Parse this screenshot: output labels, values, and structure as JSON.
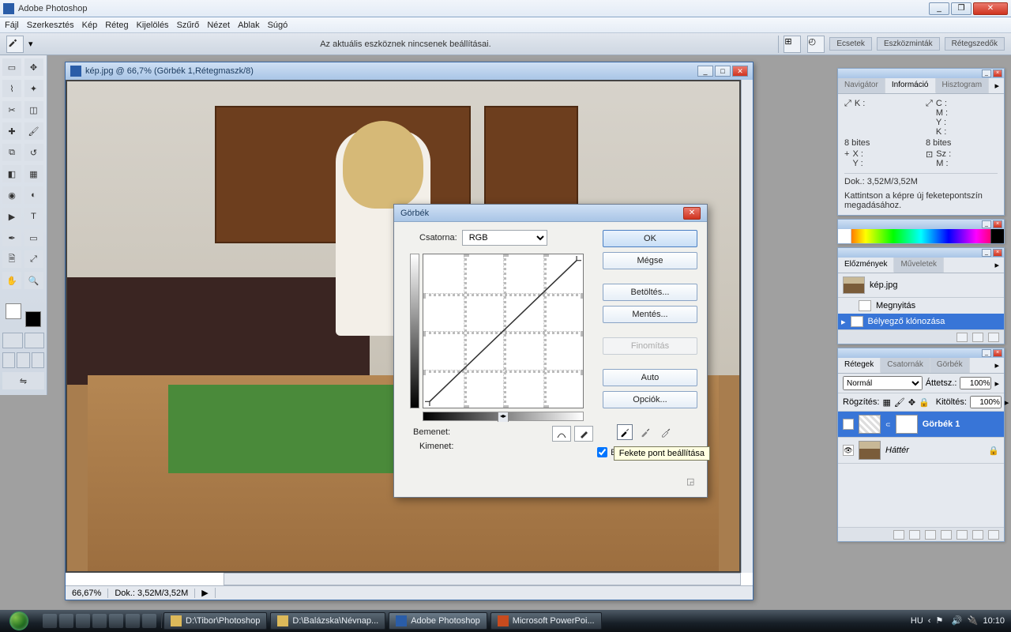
{
  "app": {
    "title": "Adobe Photoshop"
  },
  "menu": [
    "Fájl",
    "Szerkesztés",
    "Kép",
    "Réteg",
    "Kijelölés",
    "Szűrő",
    "Nézet",
    "Ablak",
    "Súgó"
  ],
  "optbar": {
    "message": "Az aktuális eszköznek nincsenek beállításai.",
    "tabs": [
      "Ecsetek",
      "Eszközminták",
      "Rétegszedők"
    ]
  },
  "doc": {
    "title": "kép.jpg @ 66,7% (Görbék 1,Rétegmaszk/8)",
    "zoom": "66,67%",
    "docsize": "Dok.: 3,52M/3,52M"
  },
  "dialog": {
    "title": "Görbék",
    "channel_label": "Csatorna:",
    "channel_value": "RGB",
    "input_label": "Bemenet:",
    "output_label": "Kimenet:",
    "btn_ok": "OK",
    "btn_cancel": "Mégse",
    "btn_load": "Betöltés...",
    "btn_save": "Mentés...",
    "btn_smooth": "Finomítás",
    "btn_auto": "Auto",
    "btn_options": "Opciók...",
    "preview_label": "Elő",
    "tooltip": "Fekete pont beállítása"
  },
  "panels": {
    "info": {
      "tabs": [
        "Navigátor",
        "Információ",
        "Hisztogram"
      ],
      "k_label": "K :",
      "cmyk": {
        "c": "C :",
        "m": "M :",
        "y": "Y :",
        "k": "K :"
      },
      "bits_left": "8 bites",
      "bits_right": "8 bites",
      "xy": {
        "x": "X :",
        "y": "Y :"
      },
      "szm": {
        "sz": "Sz :",
        "m": "M :"
      },
      "docsize": "Dok.: 3,52M/3,52M",
      "hint": "Kattintson a képre új feketepontszín megadásához."
    },
    "history": {
      "tabs": [
        "Előzmények",
        "Műveletek"
      ],
      "doc_name": "kép.jpg",
      "items": [
        "Megnyitás",
        "Bélyegző klónozása"
      ]
    },
    "layers": {
      "tabs": [
        "Rétegek",
        "Csatornák",
        "Görbék"
      ],
      "blend": "Normál",
      "opacity_label": "Áttetsz.:",
      "opacity": "100%",
      "lock_label": "Rögzítés:",
      "fill_label": "Kitöltés:",
      "fill": "100%",
      "items": [
        {
          "name": "Görbék 1",
          "locked": false
        },
        {
          "name": "Háttér",
          "locked": true
        }
      ]
    }
  },
  "taskbar": {
    "items": [
      {
        "label": "D:\\Tibor\\Photoshop",
        "color": "#dcb95a"
      },
      {
        "label": "D:\\Balázska\\Névnap...",
        "color": "#dcb95a"
      },
      {
        "label": "Adobe Photoshop",
        "color": "#2a5da8",
        "active": true
      },
      {
        "label": "Microsoft PowerPoi...",
        "color": "#c84b1e"
      }
    ],
    "lang": "HU",
    "clock": "10:10"
  }
}
